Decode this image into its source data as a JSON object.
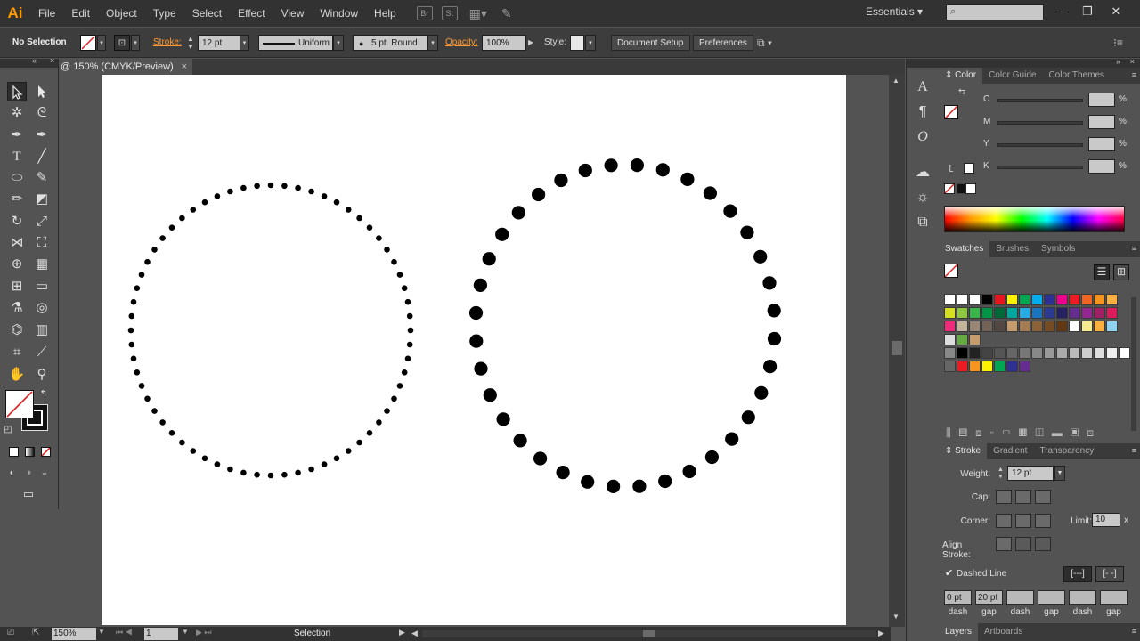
{
  "app": {
    "logo": "Ai",
    "workspace": "Essentials"
  },
  "menu": [
    "File",
    "Edit",
    "Object",
    "Type",
    "Select",
    "Effect",
    "View",
    "Window",
    "Help"
  ],
  "menubar_icons": {
    "bridge": "Br",
    "stock": "St"
  },
  "control_bar": {
    "selection_label": "No Selection",
    "stroke_label": "Stroke:",
    "stroke_weight": "12 pt",
    "profile": "Uniform",
    "brush": "5 pt. Round",
    "opacity_label": "Opacity:",
    "opacity": "100%",
    "style_label": "Style:",
    "document_setup": "Document Setup",
    "preferences": "Preferences"
  },
  "document": {
    "tab_title": "@ 150% (CMYK/Preview)",
    "close": "×"
  },
  "artwork": {
    "small_circle_dot_count": 64,
    "large_circle_dot_count": 36,
    "dot_color": "#000000"
  },
  "status_bar": {
    "zoom": "150%",
    "artboard": "1",
    "tool": "Selection"
  },
  "color_panel": {
    "tabs": [
      "Color",
      "Color Guide",
      "Color Themes"
    ],
    "channels": [
      {
        "label": "C",
        "pct": "%"
      },
      {
        "label": "M",
        "pct": "%"
      },
      {
        "label": "Y",
        "pct": "%"
      },
      {
        "label": "K",
        "pct": "%"
      }
    ]
  },
  "swatches_panel": {
    "tabs": [
      "Swatches",
      "Brushes",
      "Symbols"
    ]
  },
  "stroke_panel": {
    "tabs": [
      "Stroke",
      "Gradient",
      "Transparency"
    ],
    "weight_label": "Weight:",
    "weight": "12 pt",
    "cap_label": "Cap:",
    "corner_label": "Corner:",
    "limit_label": "Limit:",
    "limit": "10",
    "limit_unit": "x",
    "align_label": "Align Stroke:",
    "dashed_line_label": "Dashed Line",
    "dashes": [
      {
        "value": "0 pt",
        "label": "dash"
      },
      {
        "value": "20 pt",
        "label": "gap"
      },
      {
        "value": "",
        "label": "dash"
      },
      {
        "value": "",
        "label": "gap"
      },
      {
        "value": "",
        "label": "dash"
      },
      {
        "value": "",
        "label": "gap"
      }
    ]
  },
  "bottom_tabs": [
    "Layers",
    "Artboards"
  ]
}
